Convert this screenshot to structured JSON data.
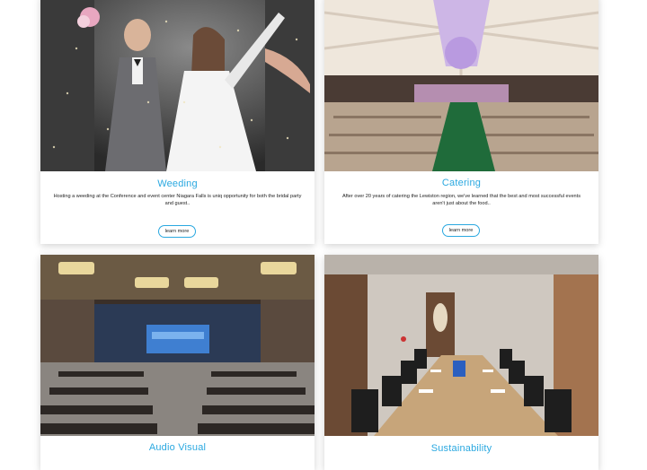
{
  "cards": [
    {
      "title": "Weeding",
      "description": "Hosting a weeding at the Conference and event center Niagara Falls is uniq opportunity for both the bridal party and guest..",
      "button": "learn more",
      "image": "wedding-couple-photo"
    },
    {
      "title": "Catering",
      "description": "After over 20 years of catering the Lewiston region, we've learned that the best and most successful events aren't just about the food..",
      "button": "learn more",
      "image": "banquet-hall-photo"
    },
    {
      "title": "Audio Visual",
      "description": "",
      "button": "",
      "image": "conference-hall-photo"
    },
    {
      "title": "Sustainability",
      "description": "",
      "button": "",
      "image": "boardroom-photo"
    }
  ],
  "colors": {
    "accent": "#2aa8e0",
    "text": "#222222",
    "background": "#ffffff"
  }
}
